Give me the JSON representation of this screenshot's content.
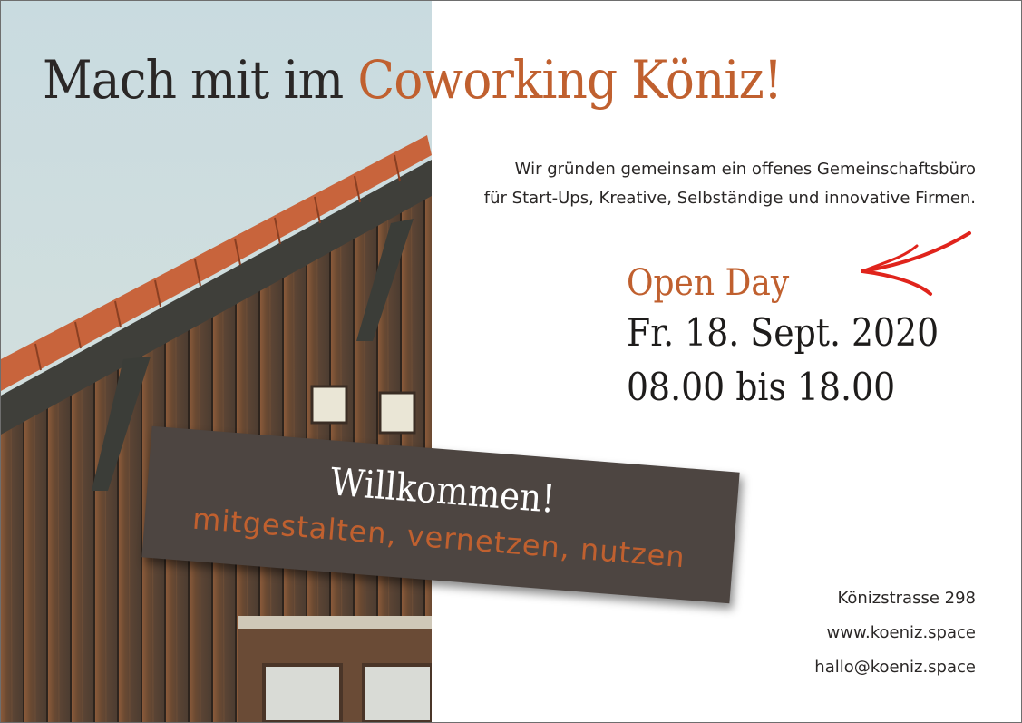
{
  "headline": {
    "part1": "Mach mit im",
    "part2": "Coworking Köniz!"
  },
  "intro": {
    "line1": "Wir gründen gemeinsam ein offenes Gemeinschaftsbüro",
    "line2": "für Start-Ups, Kreative, Selbständige und innovative Firmen."
  },
  "event": {
    "label": "Open Day",
    "date": "Fr. 18. Sept. 2020",
    "time": "08.00 bis 18.00"
  },
  "banner": {
    "welcome": "Willkommen!",
    "tagline": "mitgestalten, vernetzen, nutzen"
  },
  "contact": {
    "address": "Könizstrasse 298",
    "website": "www.koeniz.space",
    "email": "hallo@koeniz.space"
  },
  "colors": {
    "accent": "#c0602f",
    "text": "#2a2726",
    "banner": "#4d4541",
    "arrow": "#e0241c"
  },
  "icons": {
    "arrow": "hand-drawn-arrow-icon"
  }
}
